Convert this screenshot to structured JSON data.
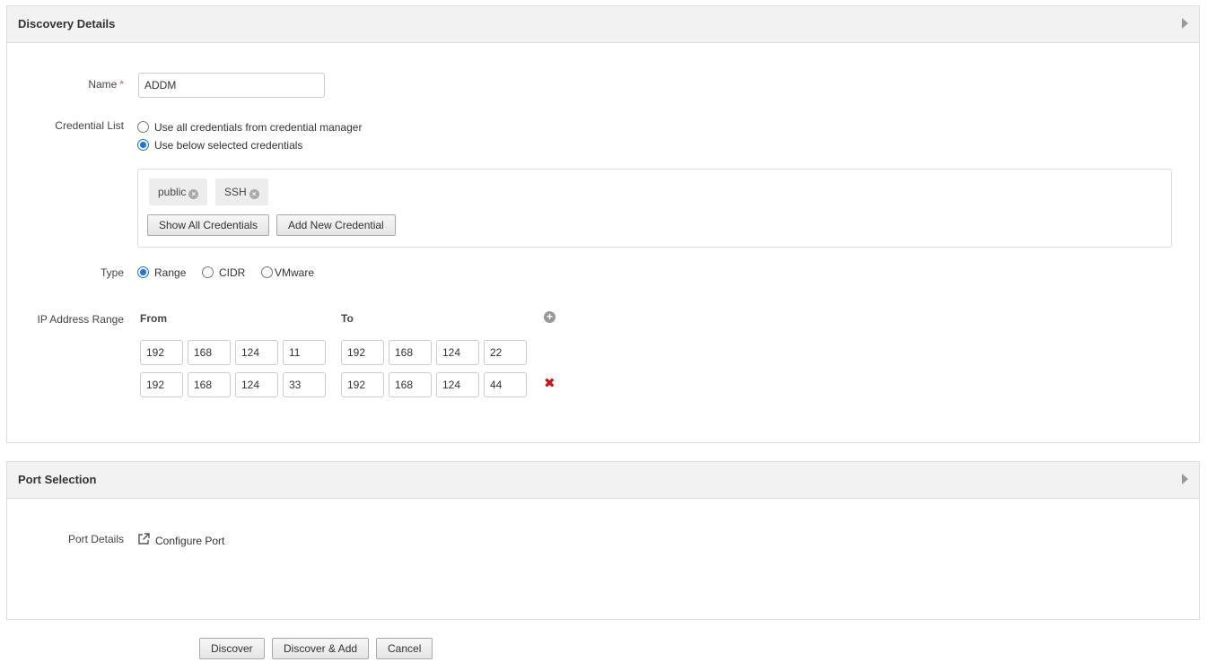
{
  "discovery": {
    "title": "Discovery Details",
    "name_label": "Name",
    "required_mark": "*",
    "name_value": "ADDM",
    "credential_label": "Credential List",
    "cred_option_all": "Use all credentials from credential manager",
    "cred_option_selected": "Use below selected credentials",
    "credentials": [
      "public",
      "SSH"
    ],
    "tag_remove_glyph": "×",
    "show_all_btn": "Show All Credentials",
    "add_new_btn": "Add New Credential",
    "type_label": "Type",
    "type_options": [
      "Range",
      "CIDR",
      "VMware"
    ],
    "type_selected": "Range",
    "ip_label": "IP Address Range",
    "from_label": "From",
    "to_label": "To",
    "add_glyph": "+",
    "delete_glyph": "✖",
    "ranges": [
      {
        "from": [
          "192",
          "168",
          "124",
          "11"
        ],
        "to": [
          "192",
          "168",
          "124",
          "22"
        ]
      },
      {
        "from": [
          "192",
          "168",
          "124",
          "33"
        ],
        "to": [
          "192",
          "168",
          "124",
          "44"
        ]
      }
    ]
  },
  "ports": {
    "title": "Port Selection",
    "details_label": "Port Details",
    "configure_link": "Configure Port"
  },
  "footer": {
    "discover": "Discover",
    "discover_add": "Discover & Add",
    "cancel": "Cancel"
  }
}
